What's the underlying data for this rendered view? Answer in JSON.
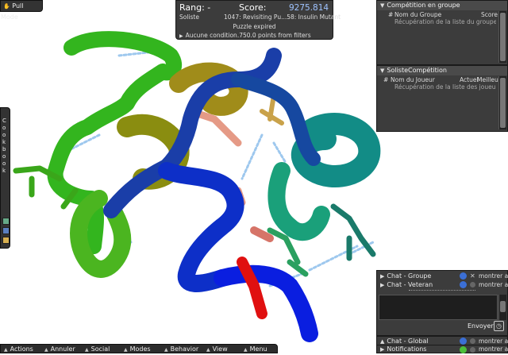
{
  "mode_button": {
    "label": "Pull Mode"
  },
  "score_panel": {
    "rank_label": "Rang: -",
    "score_label": "Score:",
    "score_value": "9275.814",
    "player_type": "Soliste",
    "puzzle_title": "1047: Revisiting Pu...58: Insulin Mutant",
    "status": "Puzzle expired",
    "condition_text": "Aucune condition.750.0 points from filters"
  },
  "cookbook": {
    "label": "Cookbook"
  },
  "group_competition": {
    "title": "Compétition en groupe",
    "col_rank": "#",
    "col_name": "Nom du Groupe",
    "col_score": "Score",
    "loading": "Récupération de la liste du groupe..."
  },
  "solo_competition": {
    "title": "SolisteCompétition",
    "col_rank": "#",
    "col_name": "Nom du Joueur",
    "col_current": "Actuel",
    "col_best": "Meilleur",
    "loading": "Récupération de la liste des joueurs..."
  },
  "chat": {
    "channels": [
      {
        "label": "Chat - Groupe",
        "toggle": "montrer aut"
      },
      {
        "label": "Chat - Veteran",
        "toggle": "montrer aut"
      }
    ],
    "send_label": "Envoyer",
    "global_label": "Chat - Global",
    "global_toggle": "montrer aut",
    "notifications_label": "Notifications",
    "notifications_toggle": "montrer aut"
  },
  "bottom_bar": {
    "items": [
      "Actions",
      "Annuler",
      "Social",
      "Modes",
      "Behavior",
      "View",
      "Menu"
    ]
  },
  "colors": {
    "panel_bg": "#2d2d2d",
    "score_value": "#9fc3ff",
    "info_icon": "#3b6fd6",
    "green_icon": "#4cbf3a"
  }
}
